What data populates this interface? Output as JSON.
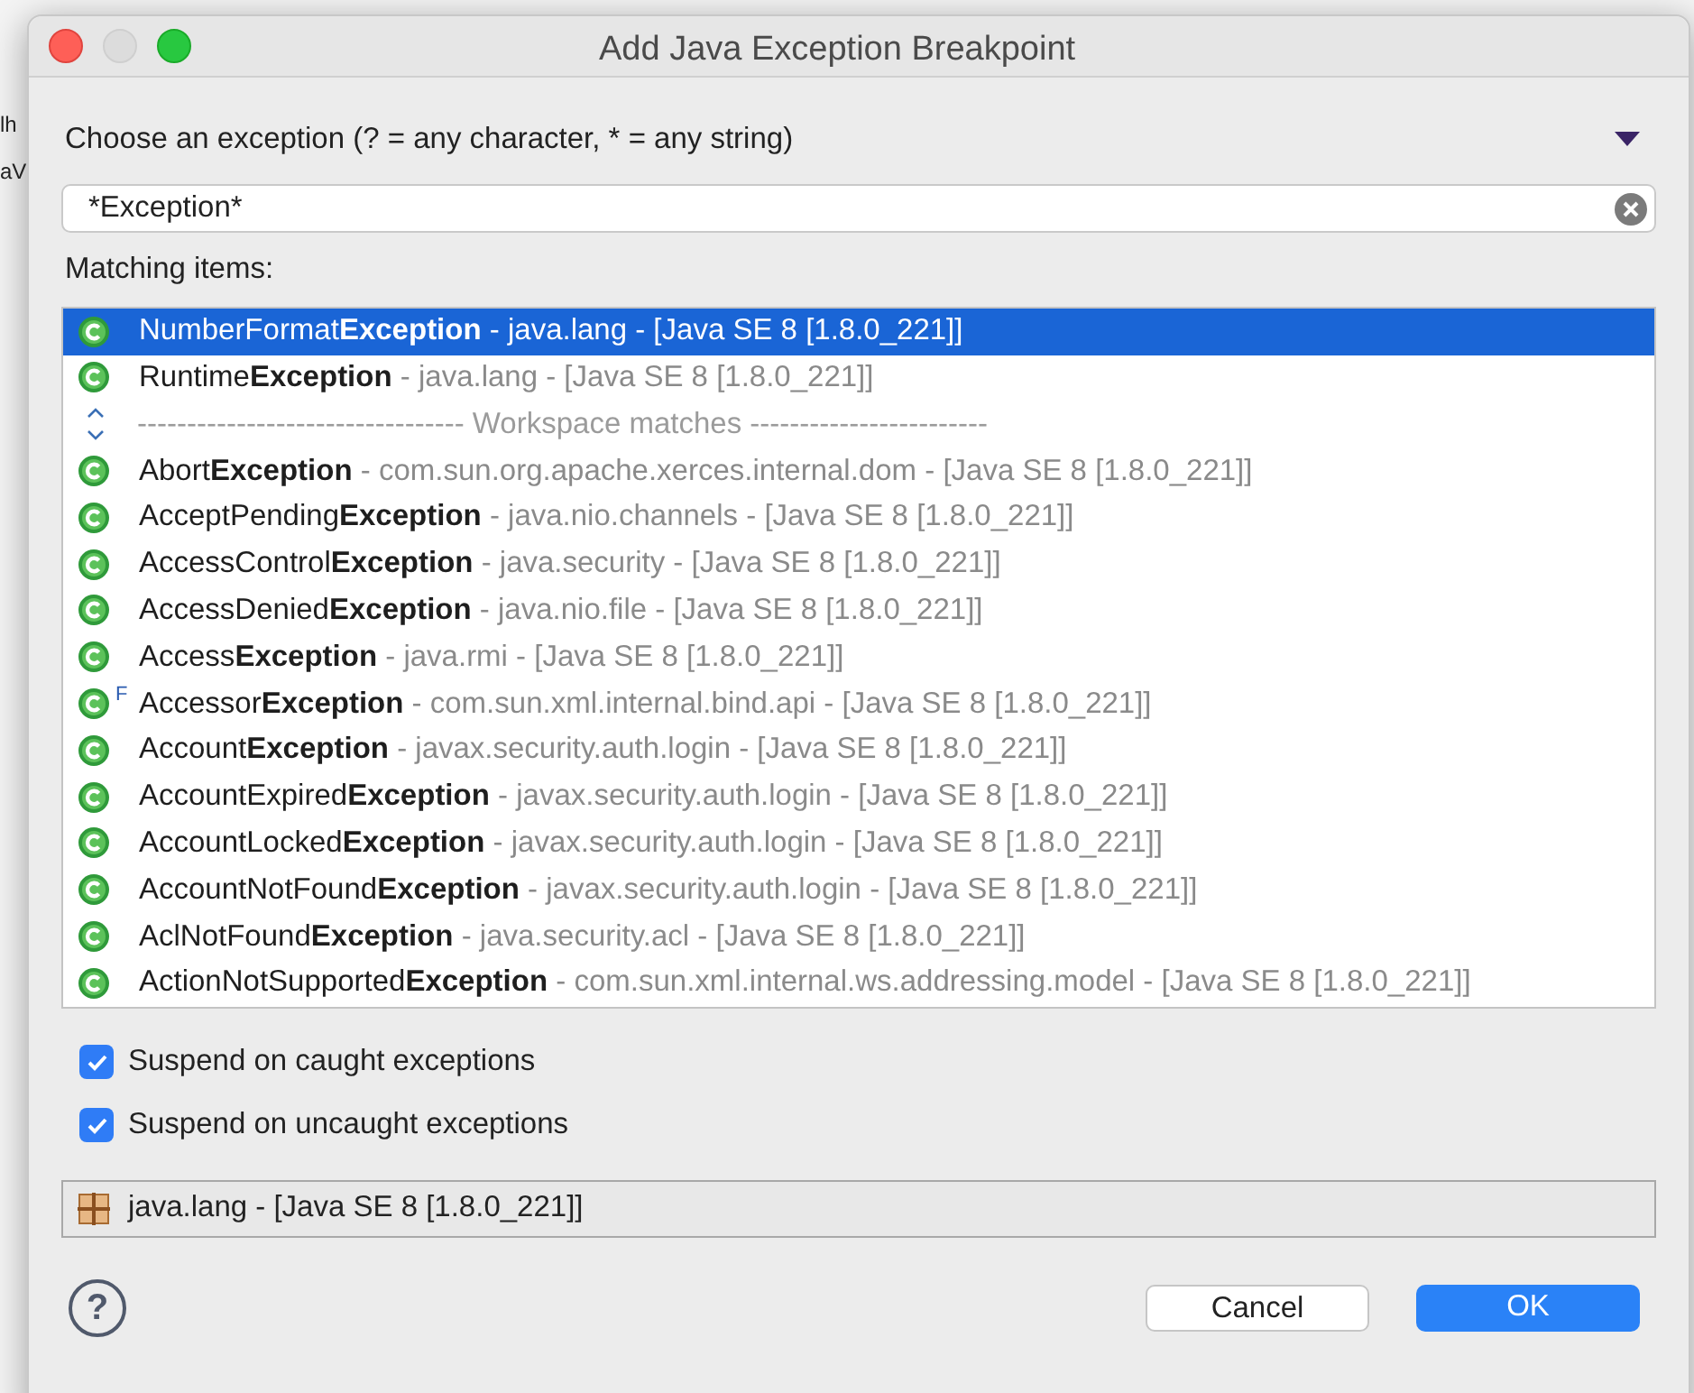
{
  "background": {
    "side_fragments": [
      "lh",
      "aV"
    ]
  },
  "window": {
    "title": "Add Java Exception Breakpoint"
  },
  "filter": {
    "label": "Choose an exception (? = any character, * = any string)",
    "value": "*Exception*"
  },
  "matching_label": "Matching items:",
  "items": [
    {
      "kind": "class",
      "selected": true,
      "name": "NumberFormat**Exception**",
      "detail": " - java.lang - [Java SE 8 [1.8.0_221]]"
    },
    {
      "kind": "class",
      "selected": false,
      "name": "Runtime**Exception**",
      "detail": " - java.lang - [Java SE 8 [1.8.0_221]]"
    },
    {
      "kind": "separator",
      "selected": false,
      "name": "--------------------------------- Workspace matches ------------------------"
    },
    {
      "kind": "class",
      "selected": false,
      "name": "Abort**Exception**",
      "detail": " - com.sun.org.apache.xerces.internal.dom - [Java SE 8 [1.8.0_221]]"
    },
    {
      "kind": "class",
      "selected": false,
      "name": "AcceptPending**Exception**",
      "detail": " - java.nio.channels - [Java SE 8 [1.8.0_221]]"
    },
    {
      "kind": "class",
      "selected": false,
      "name": "AccessControl**Exception**",
      "detail": " - java.security - [Java SE 8 [1.8.0_221]]"
    },
    {
      "kind": "class",
      "selected": false,
      "name": "AccessDenied**Exception**",
      "detail": " - java.nio.file - [Java SE 8 [1.8.0_221]]"
    },
    {
      "kind": "class",
      "selected": false,
      "name": "Access**Exception**",
      "detail": " - java.rmi - [Java SE 8 [1.8.0_221]]"
    },
    {
      "kind": "class",
      "selected": false,
      "badge": "F",
      "name": "Accessor**Exception**",
      "detail": " - com.sun.xml.internal.bind.api - [Java SE 8 [1.8.0_221]]"
    },
    {
      "kind": "class",
      "selected": false,
      "name": "Account**Exception**",
      "detail": " - javax.security.auth.login - [Java SE 8 [1.8.0_221]]"
    },
    {
      "kind": "class",
      "selected": false,
      "name": "AccountExpired**Exception**",
      "detail": " - javax.security.auth.login - [Java SE 8 [1.8.0_221]]"
    },
    {
      "kind": "class",
      "selected": false,
      "name": "AccountLocked**Exception**",
      "detail": " - javax.security.auth.login - [Java SE 8 [1.8.0_221]]"
    },
    {
      "kind": "class",
      "selected": false,
      "name": "AccountNotFound**Exception**",
      "detail": " - javax.security.auth.login - [Java SE 8 [1.8.0_221]]"
    },
    {
      "kind": "class",
      "selected": false,
      "name": "AclNotFound**Exception**",
      "detail": " - java.security.acl - [Java SE 8 [1.8.0_221]]"
    },
    {
      "kind": "class",
      "selected": false,
      "name": "ActionNotSupported**Exception**",
      "detail": " - com.sun.xml.internal.ws.addressing.model - [Java SE 8 [1.8.0_221]]"
    }
  ],
  "options": [
    {
      "label": "Suspend on caught exceptions",
      "checked": true
    },
    {
      "label": "Suspend on uncaught exceptions",
      "checked": true
    }
  ],
  "package_status": "java.lang - [Java SE 8 [1.8.0_221]]",
  "help": "?",
  "buttons": [
    {
      "label": "Cancel",
      "kind": "secondary"
    },
    {
      "label": "OK",
      "kind": "primary"
    }
  ]
}
